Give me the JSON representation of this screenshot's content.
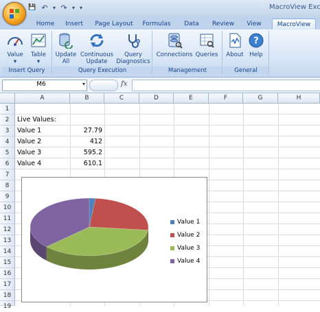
{
  "title_bar": {
    "window_title": "MacroView Exce"
  },
  "quick_access": {
    "save": "💾",
    "undo": "↶",
    "redo": "↷",
    "customize": "▾",
    "undo_dd": "▾",
    "redo_dd": "▾"
  },
  "tabs": [
    "Home",
    "Insert",
    "Page Layout",
    "Formulas",
    "Data",
    "Review",
    "View",
    "MacroView"
  ],
  "active_tab": "MacroView",
  "ribbon": {
    "groups": [
      {
        "label": "Insert Query",
        "buttons": [
          {
            "l1": "Value",
            "l2": "▾",
            "icon": "gauge-icon"
          },
          {
            "l1": "Table",
            "l2": "▾",
            "icon": "table-chart-icon"
          }
        ]
      },
      {
        "label": "Query Execution",
        "buttons": [
          {
            "l1": "Update",
            "l2": "All",
            "icon": "database-refresh-icon"
          },
          {
            "l1": "Continuous",
            "l2": "Update",
            "icon": "refresh-arrows-icon"
          },
          {
            "l1": "Query",
            "l2": "Diagnostics",
            "icon": "stethoscope-icon"
          }
        ]
      },
      {
        "label": "Management",
        "buttons": [
          {
            "l1": "Connections",
            "l2": "",
            "icon": "connections-icon"
          },
          {
            "l1": "Queries",
            "l2": "",
            "icon": "queries-icon"
          }
        ]
      },
      {
        "label": "General",
        "buttons": [
          {
            "l1": "About",
            "l2": "",
            "icon": "about-icon"
          },
          {
            "l1": "Help",
            "l2": "",
            "icon": "help-icon"
          }
        ]
      }
    ]
  },
  "formula_bar": {
    "name_box": "M6",
    "name_box_dd": "▾",
    "fx": "fx",
    "formula": ""
  },
  "sheet": {
    "columns": [
      "A",
      "B",
      "C",
      "D",
      "E",
      "F",
      "G",
      "H"
    ],
    "rows": [
      "1",
      "2",
      "3",
      "4",
      "5",
      "6",
      "7",
      "8",
      "9",
      "10",
      "11",
      "12",
      "13",
      "14",
      "15",
      "16",
      "17",
      "18",
      "19"
    ],
    "header_label": "Live Values:",
    "items": [
      {
        "label": "Value 1",
        "value": "27.79"
      },
      {
        "label": "Value 2",
        "value": "412"
      },
      {
        "label": "Value 3",
        "value": "595.2"
      },
      {
        "label": "Value 4",
        "value": "610.1"
      }
    ]
  },
  "chart_data": {
    "type": "pie",
    "categories": [
      "Value 1",
      "Value 2",
      "Value 3",
      "Value 4"
    ],
    "values": [
      27.79,
      412,
      595.2,
      610.1
    ],
    "colors": [
      "#4f81bd",
      "#c0504d",
      "#9bbb59",
      "#8064a2"
    ],
    "title": "",
    "legend": "right",
    "style": "3d"
  }
}
